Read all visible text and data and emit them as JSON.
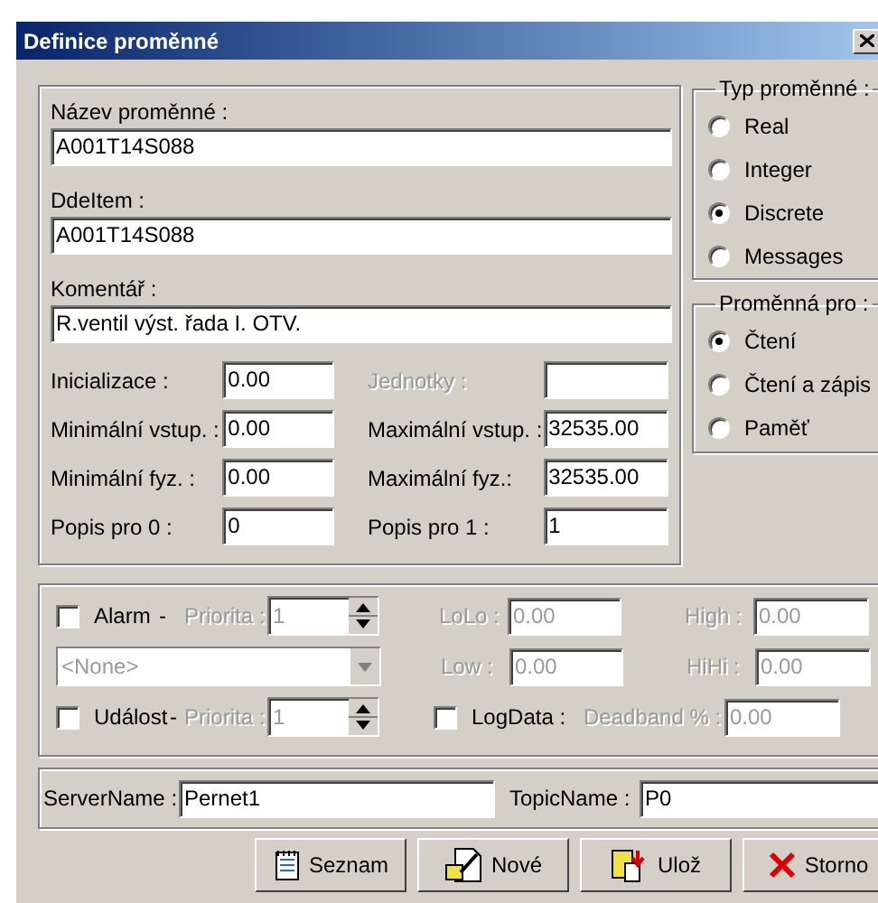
{
  "window": {
    "title": "Definice proměnné"
  },
  "variable": {
    "fields": [
      {
        "label": "Název proměnné :",
        "value": "A001T14S088"
      },
      {
        "label": "DdeItem :",
        "value": "A001T14S088"
      },
      {
        "label": "Komentář :",
        "value": "R.ventil výst. řada I. OTV."
      }
    ],
    "grid": [
      {
        "left": {
          "label": "Inicializace :",
          "value": "0.00",
          "disabled": false
        },
        "right": {
          "label": "Jednotky :",
          "disabled": true
        }
      },
      {
        "left": {
          "label": "Minimální vstup. :",
          "value": "0.00",
          "disabled": false
        },
        "right": {
          "label": "Maximální vstup. :",
          "value": "32535.00",
          "disabled": false
        }
      },
      {
        "left": {
          "label": "Minimální fyz. :",
          "value": "0.00",
          "disabled": false
        },
        "right": {
          "label": "Maximální fyz.:",
          "value": "32535.00",
          "disabled": false
        }
      },
      {
        "left": {
          "label": "Popis pro 0 :",
          "value": "0",
          "disabled": false
        },
        "right": {
          "label": "Popis pro 1 :",
          "value": "1",
          "disabled": false
        }
      }
    ]
  },
  "type_group": {
    "title": "Typ proměnné :",
    "options": [
      {
        "label": "Real",
        "selected": false
      },
      {
        "label": "Integer",
        "selected": false
      },
      {
        "label": "Discrete",
        "selected": true
      },
      {
        "label": "Messages",
        "selected": false
      }
    ]
  },
  "usage_group": {
    "title": "Proměnná pro :",
    "options": [
      {
        "label": "Čtení",
        "selected": true
      },
      {
        "label": "Čtení a zápis",
        "selected": false
      },
      {
        "label": "Paměť",
        "selected": false
      }
    ]
  },
  "alarm": {
    "alarm_check": {
      "label": "Alarm",
      "checked": false
    },
    "alarm_dash": "-",
    "alarm_priority": {
      "label": "Priorita :",
      "value": "1",
      "disabled": true
    },
    "class_select": {
      "value": "<None>",
      "disabled": true
    },
    "event_check": {
      "label": "Událost",
      "checked": false
    },
    "event_dash": "-",
    "event_priority": {
      "label": "Priorita :",
      "value": "1",
      "disabled": true
    },
    "limits": [
      {
        "label": "LoLo :",
        "value": "0.00",
        "disabled": true
      },
      {
        "label": "High :",
        "value": "0.00",
        "disabled": true
      },
      {
        "label": "Low :",
        "value": "0.00",
        "disabled": true
      },
      {
        "label": "HiHi :",
        "value": "0.00",
        "disabled": true
      }
    ],
    "logdata": {
      "label": "LogData :",
      "checked": false
    },
    "deadband": {
      "label": "Deadband % :",
      "value": "0.00",
      "disabled": true
    }
  },
  "server": {
    "fields": [
      {
        "label": "ServerName :",
        "value": "Pernet1"
      },
      {
        "label": "TopicName :",
        "value": "P0"
      }
    ]
  },
  "buttons": [
    {
      "label": "Seznam",
      "kind": "list"
    },
    {
      "label": "Nové",
      "kind": "new"
    },
    {
      "label": "Ulož",
      "kind": "save"
    },
    {
      "label": "Storno",
      "kind": "cancel"
    }
  ]
}
